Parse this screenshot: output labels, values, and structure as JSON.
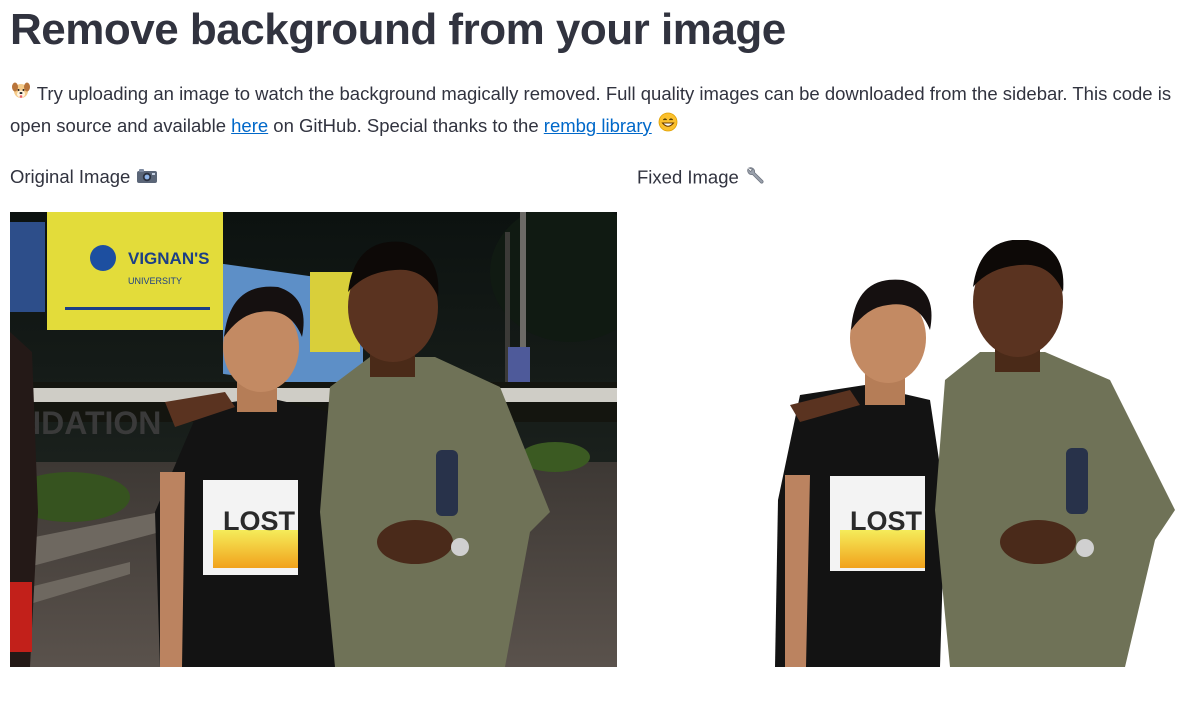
{
  "header": {
    "title": "Remove background from your image"
  },
  "intro": {
    "emoji_icon": "dog-face-icon",
    "text_before_link": " Try uploading an image to watch the background magically removed. Full quality images can be downloaded from the sidebar. This code is open source and available ",
    "here_link": "here",
    "text_between": " on GitHub. Special thanks to the ",
    "library_link": "rembg library",
    "end_emoji_icon": "grinning-face-icon"
  },
  "columns": {
    "original_label": "Original Image",
    "original_icon": "camera-icon",
    "fixed_label": "Fixed Image",
    "fixed_icon": "wrench-icon"
  },
  "photo": {
    "sign_name": "VIGNAN'S",
    "sign_sub": "UNIVERSITY",
    "wall_text": "NDATION",
    "shirt_text": "LOST"
  },
  "colors": {
    "link": "#0068c9",
    "text": "#31333f",
    "banner_yellow": "#e3dc3a"
  }
}
